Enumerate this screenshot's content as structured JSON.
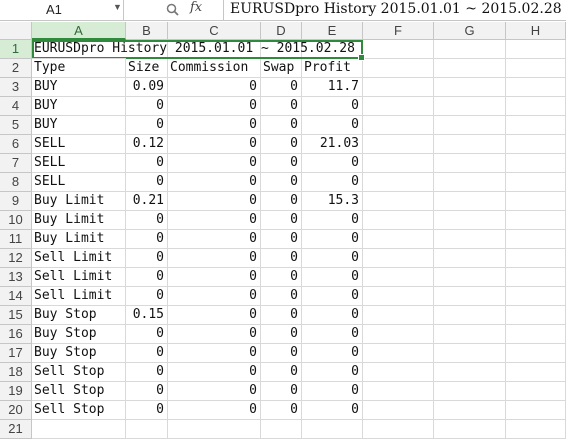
{
  "formula_bar": {
    "name_box": "A1",
    "fx_label": "fx",
    "content": "EURUSDpro History 2015.01.01 ~ 2015.02.28"
  },
  "columns": [
    "A",
    "B",
    "C",
    "D",
    "E",
    "F",
    "G",
    "H"
  ],
  "rows": [
    [
      "EURUSDpro History 2015.01.01 ~ 2015.02.28",
      "",
      "",
      "",
      ""
    ],
    [
      "Type",
      "Size",
      "Commission",
      "Swap",
      "Profit"
    ],
    [
      "BUY",
      "0.09",
      "0",
      "0",
      "11.7"
    ],
    [
      "BUY",
      "0",
      "0",
      "0",
      "0"
    ],
    [
      "BUY",
      "0",
      "0",
      "0",
      "0"
    ],
    [
      "SELL",
      "0.12",
      "0",
      "0",
      "21.03"
    ],
    [
      "SELL",
      "0",
      "0",
      "0",
      "0"
    ],
    [
      "SELL",
      "0",
      "0",
      "0",
      "0"
    ],
    [
      "Buy Limit",
      "0.21",
      "0",
      "0",
      "15.3"
    ],
    [
      "Buy Limit",
      "0",
      "0",
      "0",
      "0"
    ],
    [
      "Buy Limit",
      "0",
      "0",
      "0",
      "0"
    ],
    [
      "Sell Limit",
      "0",
      "0",
      "0",
      "0"
    ],
    [
      "Sell Limit",
      "0",
      "0",
      "0",
      "0"
    ],
    [
      "Sell Limit",
      "0",
      "0",
      "0",
      "0"
    ],
    [
      "Buy Stop",
      "0.15",
      "0",
      "0",
      "0"
    ],
    [
      "Buy Stop",
      "0",
      "0",
      "0",
      "0"
    ],
    [
      "Buy Stop",
      "0",
      "0",
      "0",
      "0"
    ],
    [
      "Sell Stop",
      "0",
      "0",
      "0",
      "0"
    ],
    [
      "Sell Stop",
      "0",
      "0",
      "0",
      "0"
    ],
    [
      "Sell Stop",
      "0",
      "0",
      "0",
      "0"
    ],
    [
      "",
      "",
      "",
      "",
      ""
    ]
  ],
  "colors": {
    "selection": "#2f8a3c",
    "header_bg": "#f2f2f2",
    "header_selected_bg": "#d6ecd4"
  }
}
